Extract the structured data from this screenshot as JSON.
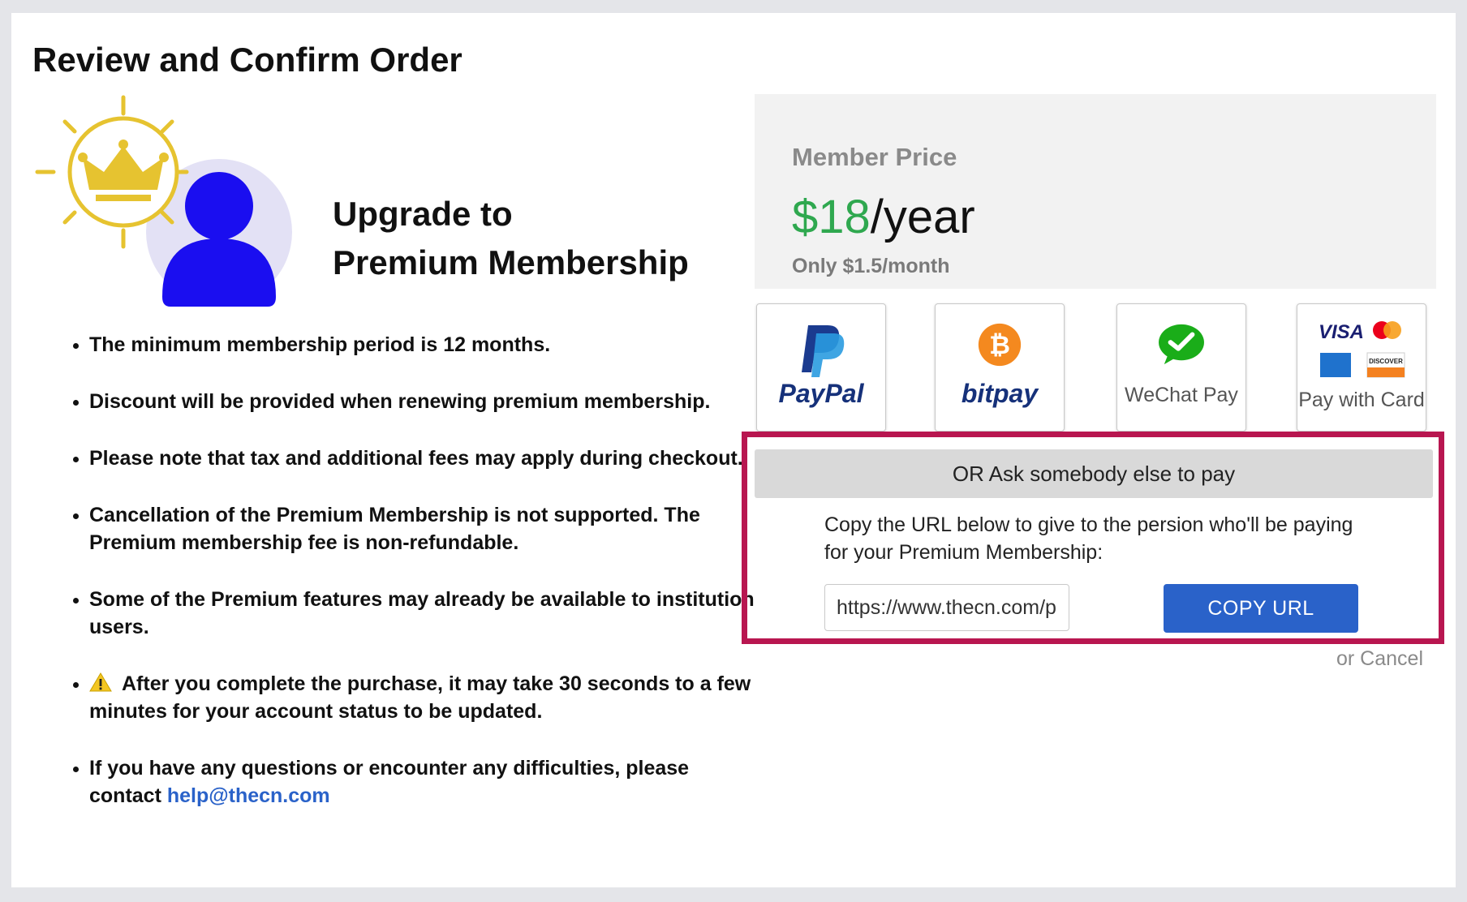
{
  "page": {
    "title": "Review and Confirm Order"
  },
  "hero": {
    "line1": "Upgrade to",
    "line2": "Premium Membership"
  },
  "terms": [
    "The minimum membership period is 12 months.",
    "Discount will be provided when renewing premium membership.",
    "Please note that tax and additional fees may apply during checkout.",
    "Cancellation of the Premium Membership is not supported. The Premium membership fee is non-refundable.",
    "Some of the Premium features may already be available to institution users.",
    "After you complete the purchase, it may take 30 seconds to a few minutes for your account status to be updated.",
    "If you have any questions or encounter any difficulties, please contact "
  ],
  "contact_email": "help@thecn.com",
  "price": {
    "label": "Member Price",
    "amount": "$18",
    "period": "/year",
    "monthly": "Only $1.5/month",
    "amount_color": "#2fa84f"
  },
  "payment_methods": [
    {
      "name": "PayPal",
      "icon": "paypal-icon"
    },
    {
      "name": "bitpay",
      "icon": "bitcoin-icon"
    },
    {
      "name": "WeChat Pay",
      "icon": "wechat-icon"
    },
    {
      "name": "Pay with Card",
      "icon": "card-brands-icon"
    }
  ],
  "ask_other": {
    "header": "OR Ask somebody else to pay",
    "description": "Copy the URL below to give to the persion who'll be paying for your Premium Membership:",
    "url_value": "https://www.thecn.com/premium",
    "copy_label": "COPY URL",
    "highlight_color": "#b81650"
  },
  "cancel": "or Cancel",
  "colors": {
    "accent": "#2a62c9",
    "avatar": "#1a0ef0",
    "crown": "#e6c330"
  }
}
